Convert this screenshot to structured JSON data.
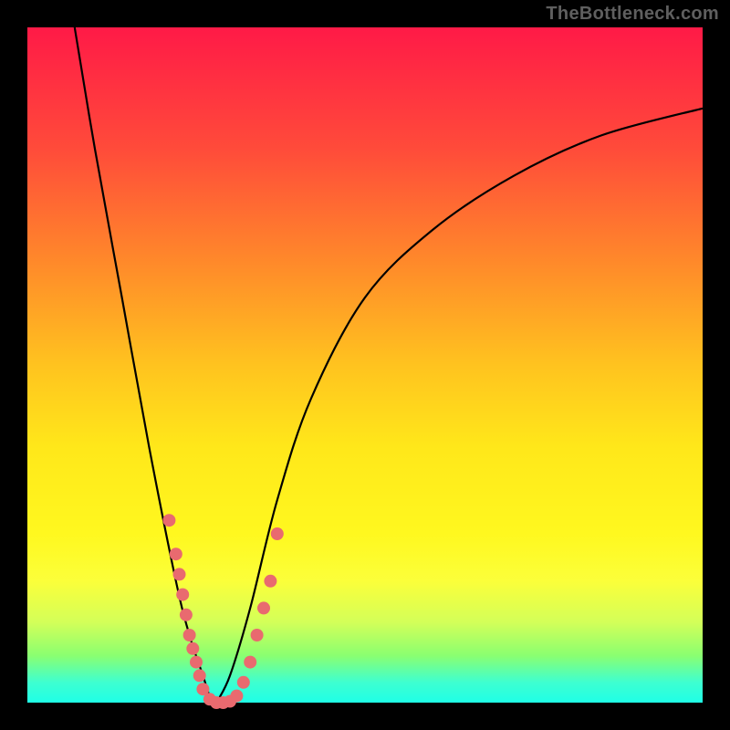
{
  "watermark": "TheBottleneck.com",
  "chart_data": {
    "type": "line",
    "title": "",
    "xlabel": "",
    "ylabel": "",
    "xlim": [
      0,
      100
    ],
    "ylim": [
      0,
      100
    ],
    "series": [
      {
        "name": "left-branch",
        "x": [
          7,
          10,
          14,
          18,
          22,
          24,
          26,
          27,
          28
        ],
        "y": [
          100,
          82,
          60,
          38,
          18,
          10,
          4,
          1,
          0
        ]
      },
      {
        "name": "right-branch",
        "x": [
          28,
          30,
          33,
          37,
          42,
          50,
          60,
          72,
          85,
          100
        ],
        "y": [
          0,
          4,
          14,
          30,
          45,
          60,
          70,
          78,
          84,
          88
        ]
      }
    ],
    "scatter": {
      "name": "data-points",
      "points": [
        {
          "x": 21,
          "y": 27
        },
        {
          "x": 22,
          "y": 22
        },
        {
          "x": 22.5,
          "y": 19
        },
        {
          "x": 23,
          "y": 16
        },
        {
          "x": 23.5,
          "y": 13
        },
        {
          "x": 24,
          "y": 10
        },
        {
          "x": 24.5,
          "y": 8
        },
        {
          "x": 25,
          "y": 6
        },
        {
          "x": 25.5,
          "y": 4
        },
        {
          "x": 26,
          "y": 2
        },
        {
          "x": 27,
          "y": 0.5
        },
        {
          "x": 28,
          "y": 0
        },
        {
          "x": 29,
          "y": 0
        },
        {
          "x": 30,
          "y": 0.2
        },
        {
          "x": 31,
          "y": 1
        },
        {
          "x": 32,
          "y": 3
        },
        {
          "x": 33,
          "y": 6
        },
        {
          "x": 34,
          "y": 10
        },
        {
          "x": 35,
          "y": 14
        },
        {
          "x": 36,
          "y": 18
        },
        {
          "x": 37,
          "y": 25
        }
      ]
    },
    "colors": {
      "gradient_top": "#ff1a47",
      "gradient_mid": "#ffe71a",
      "gradient_bottom": "#1fffe6",
      "curve": "#000000",
      "dots": "#e96a6f",
      "frame": "#000000"
    }
  }
}
